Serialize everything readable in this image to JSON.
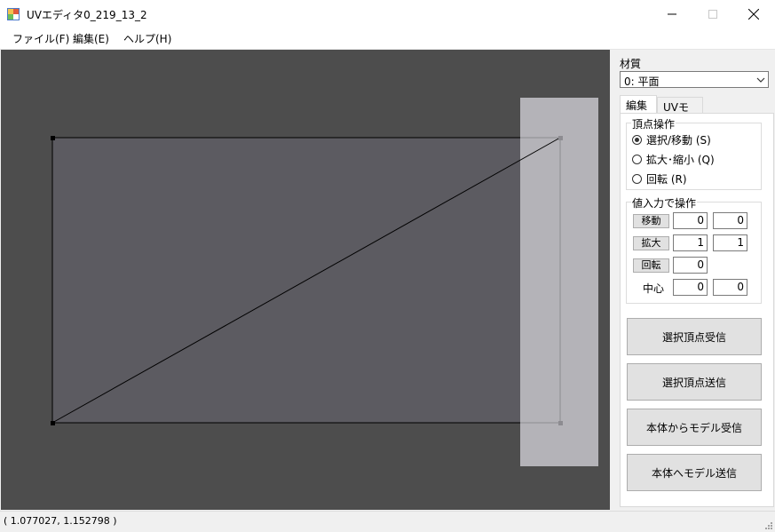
{
  "window": {
    "title": "UVエディタ0_219_13_2",
    "icon": "app-icon"
  },
  "menu": [
    {
      "label": "ファイル(F)"
    },
    {
      "label": "編集(E)"
    },
    {
      "label": "ヘルプ(H)"
    }
  ],
  "panel": {
    "material_label": "材質",
    "material_value": "0: 平面",
    "tabs": [
      {
        "label": "編集",
        "active": true
      },
      {
        "label": "UVモーフ",
        "active": false
      }
    ],
    "vertex_group": {
      "title": "頂点操作",
      "options": [
        {
          "label": "選択/移動 (S)",
          "checked": true
        },
        {
          "label": "拡大･縮小 (Q)",
          "checked": false
        },
        {
          "label": "回転 (R)",
          "checked": false
        }
      ]
    },
    "value_group": {
      "title": "値入力で操作",
      "move": {
        "label": "移動",
        "x": "0",
        "y": "0"
      },
      "scale": {
        "label": "拡大",
        "x": "1",
        "y": "1"
      },
      "rotate": {
        "label": "回転",
        "value": "0"
      },
      "center": {
        "label": "中心",
        "x": "0",
        "y": "0"
      }
    },
    "buttons": {
      "receive_selected": "選択頂点受信",
      "send_selected": "選択頂点送信",
      "receive_model": "本体からモデル受信",
      "send_model": "本体へモデル送信"
    }
  },
  "status": {
    "coords": "( 1.077027, 1.152798 )"
  },
  "colors": {
    "canvas_bg": "#4d4d4d",
    "texture_area": "#5c5b61",
    "overlay": "#b4b3b8",
    "accent": "#0078d7"
  }
}
